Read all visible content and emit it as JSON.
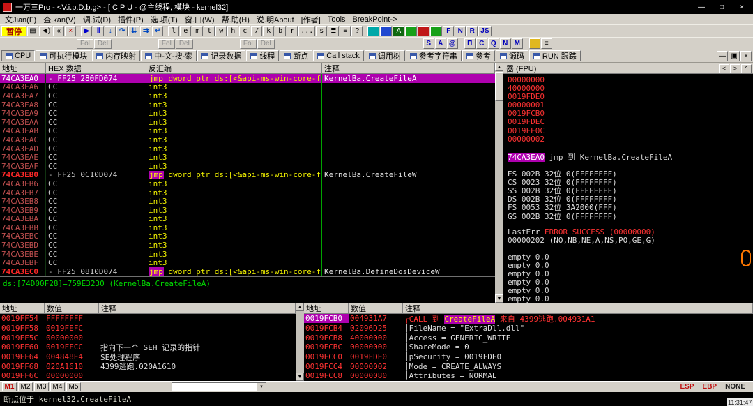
{
  "titlebar": {
    "title": "一万三Pro - <V.i.p.D.b.g> - [ C P U - @主线程, 模块 - kernel32]",
    "minimize": "—",
    "maximize": "□",
    "close": "×"
  },
  "menubar": {
    "items": [
      "文Jian(F)",
      "查.kan(V)",
      "调.试(D)",
      "插件(P)",
      "选.项(T)",
      "窗.口(W)",
      "帮.助(H)",
      "说.明About",
      "[作者]",
      "Tools",
      "BreakPoint->"
    ]
  },
  "toolbar_main": {
    "items": [
      {
        "name": "pause-button",
        "label": "暂停",
        "kind": "pause"
      },
      {
        "name": "log-window-icon",
        "label": "▤",
        "kind": "icon"
      },
      {
        "name": "sound-toggle-icon",
        "label": "◄)",
        "kind": "icon"
      },
      {
        "name": "restart-icon",
        "label": "«",
        "kind": "icon"
      },
      {
        "name": "close-program-icon",
        "label": "×",
        "kind": "icon red"
      },
      {
        "kind": "sep"
      },
      {
        "name": "run-button",
        "label": "▶",
        "kind": "icon blue"
      },
      {
        "name": "pause-execution-button",
        "label": "Ⅱ",
        "kind": "icon blue"
      },
      {
        "name": "step-into-button",
        "label": "↓",
        "kind": "step"
      },
      {
        "name": "step-over-button",
        "label": "↷",
        "kind": "step"
      },
      {
        "name": "animate-into-button",
        "label": "⇊",
        "kind": "step"
      },
      {
        "name": "animate-over-button",
        "label": "⇉",
        "kind": "step"
      },
      {
        "name": "execute-till-return-button",
        "label": "↵",
        "kind": "step"
      },
      {
        "kind": "sep"
      },
      {
        "name": "log-button",
        "label": "l",
        "kind": "letter"
      },
      {
        "name": "executables-button",
        "label": "e",
        "kind": "letter"
      },
      {
        "name": "memory-button",
        "label": "m",
        "kind": "letter"
      },
      {
        "name": "threads-button",
        "label": "t",
        "kind": "letter"
      },
      {
        "name": "windows-button",
        "label": "w",
        "kind": "letter"
      },
      {
        "name": "handles-button",
        "label": "h",
        "kind": "letter"
      },
      {
        "name": "cpu-button",
        "label": "c",
        "kind": "letter"
      },
      {
        "name": "patches-button",
        "label": "/",
        "kind": "letter"
      },
      {
        "name": "callstack-button",
        "label": "k",
        "kind": "letter"
      },
      {
        "name": "breakpoints-button",
        "label": "b",
        "kind": "letter"
      },
      {
        "name": "references-button",
        "label": "r",
        "kind": "letter"
      },
      {
        "name": "runtrace-button",
        "label": "...",
        "kind": "letter"
      },
      {
        "name": "source-button",
        "label": "s",
        "kind": "letter"
      },
      {
        "name": "windows-list-icon",
        "label": "≣",
        "kind": "icon"
      },
      {
        "name": "options-list-icon",
        "label": "≡",
        "kind": "icon"
      },
      {
        "name": "help-button",
        "label": "?",
        "kind": "icon"
      },
      {
        "kind": "sep"
      },
      {
        "name": "plugin-button-1",
        "label": "",
        "kind": "sw sw-teal"
      },
      {
        "name": "plugin-button-2",
        "label": "",
        "kind": "sw sw-blue"
      },
      {
        "name": "plugin-button-3",
        "label": "A",
        "kind": "sw sw-green"
      },
      {
        "name": "plugin-button-4",
        "label": "",
        "kind": "sw sw-green2"
      },
      {
        "name": "plugin-button-5",
        "label": "",
        "kind": "sw sw-red"
      },
      {
        "name": "plugin-button-6",
        "label": "",
        "kind": "sw sw-green2"
      },
      {
        "name": "f-plugin-button",
        "label": "F",
        "kind": "letterblue"
      },
      {
        "name": "n-plugin-button",
        "label": "N",
        "kind": "letterblue"
      },
      {
        "name": "r-plugin-button",
        "label": "R",
        "kind": "letterblue"
      },
      {
        "name": "js-plugin-button",
        "label": "JS",
        "kind": "letterblue"
      }
    ]
  },
  "toolbar_fol": {
    "groups": [
      [
        "Fol",
        "Del"
      ],
      [
        "Fol",
        "Del"
      ],
      [
        "Fol",
        "Del"
      ]
    ],
    "right_items": [
      {
        "name": "s-button",
        "label": "S",
        "kind": "letterblue"
      },
      {
        "name": "a-button",
        "label": "A",
        "kind": "letterblue"
      },
      {
        "name": "at-button",
        "label": "@",
        "kind": "letterblue"
      },
      {
        "name": "pi-button",
        "label": "Π",
        "kind": "letterblue gapl"
      },
      {
        "name": "c-button",
        "label": "C",
        "kind": "letterblue"
      },
      {
        "name": "q-button",
        "label": "Q",
        "kind": "letterblue"
      },
      {
        "name": "n-button",
        "label": "N",
        "kind": "letterblue"
      },
      {
        "name": "m-button",
        "label": "M",
        "kind": "letterblue"
      },
      {
        "name": "script-icon",
        "label": "",
        "kind": "gold gapl"
      },
      {
        "name": "list-icon",
        "label": "≡",
        "kind": "icon"
      }
    ]
  },
  "tabbar": {
    "tabs": [
      {
        "name": "cpu",
        "label": "CPU",
        "active": true
      },
      {
        "name": "executable-modules",
        "label": "可执行模块"
      },
      {
        "name": "memory-map",
        "label": "内存映射"
      },
      {
        "name": "chinese-search",
        "label": "中-文-搜-索"
      },
      {
        "name": "record-data",
        "label": "记录数据"
      },
      {
        "name": "threads",
        "label": "线程"
      },
      {
        "name": "breakpoints",
        "label": "断点"
      },
      {
        "name": "call-stack",
        "label": "Call stack"
      },
      {
        "name": "call-tree",
        "label": "调用树"
      },
      {
        "name": "reference-strings",
        "label": "参考字符串"
      },
      {
        "name": "references",
        "label": "参考"
      },
      {
        "name": "source",
        "label": "源码"
      },
      {
        "name": "run-trace",
        "label": "RUN 跟踪"
      }
    ],
    "mdi": {
      "minimize": "—",
      "restore": "▣",
      "close": "×"
    }
  },
  "disasm": {
    "headers": [
      "地址",
      "HEX 数据",
      "反汇编",
      "注释"
    ],
    "rows": [
      {
        "addr": "74CA3EA0",
        "hex": "- FF25 280FD074",
        "mn": "jmp",
        "op": "dword ptr ds:[<&api-ms-win-core-fil",
        "comment": "KernelBa.CreateFileA",
        "sel": true
      },
      {
        "addr": "74CA3EA6",
        "hex": "CC",
        "mn": "int3"
      },
      {
        "addr": "74CA3EA7",
        "hex": "CC",
        "mn": "int3"
      },
      {
        "addr": "74CA3EA8",
        "hex": "CC",
        "mn": "int3"
      },
      {
        "addr": "74CA3EA9",
        "hex": "CC",
        "mn": "int3"
      },
      {
        "addr": "74CA3EAA",
        "hex": "CC",
        "mn": "int3"
      },
      {
        "addr": "74CA3EAB",
        "hex": "CC",
        "mn": "int3"
      },
      {
        "addr": "74CA3EAC",
        "hex": "CC",
        "mn": "int3"
      },
      {
        "addr": "74CA3EAD",
        "hex": "CC",
        "mn": "int3"
      },
      {
        "addr": "74CA3EAE",
        "hex": "CC",
        "mn": "int3"
      },
      {
        "addr": "74CA3EAF",
        "hex": "CC",
        "mn": "int3"
      },
      {
        "addr": "74CA3EB0",
        "hex": "- FF25 0C10D074",
        "mn": "jmp",
        "op": "dword ptr ds:[<&api-ms-win-core-fil",
        "comment": "KernelBa.CreateFileW",
        "bp": true
      },
      {
        "addr": "74CA3EB6",
        "hex": "CC",
        "mn": "int3"
      },
      {
        "addr": "74CA3EB7",
        "hex": "CC",
        "mn": "int3"
      },
      {
        "addr": "74CA3EB8",
        "hex": "CC",
        "mn": "int3"
      },
      {
        "addr": "74CA3EB9",
        "hex": "CC",
        "mn": "int3"
      },
      {
        "addr": "74CA3EBA",
        "hex": "CC",
        "mn": "int3"
      },
      {
        "addr": "74CA3EBB",
        "hex": "CC",
        "mn": "int3"
      },
      {
        "addr": "74CA3EBC",
        "hex": "CC",
        "mn": "int3"
      },
      {
        "addr": "74CA3EBD",
        "hex": "CC",
        "mn": "int3"
      },
      {
        "addr": "74CA3EBE",
        "hex": "CC",
        "mn": "int3"
      },
      {
        "addr": "74CA3EBF",
        "hex": "CC",
        "mn": "int3"
      },
      {
        "addr": "74CA3EC0",
        "hex": "- FF25 0810D074",
        "mn": "jmp",
        "op": "dword ptr ds:[<&api-ms-win-core-fil",
        "comment": "KernelBa.DefineDosDeviceW",
        "bp": true
      }
    ]
  },
  "info_line": "ds:[74D00F28]=759E3230 (KernelBa.CreateFileA)",
  "registers": {
    "title": "器 (FPU)",
    "nav": [
      "<",
      ">",
      "^"
    ],
    "lines": [
      {
        "parts": [
          {
            "t": "00000000",
            "c": "val"
          }
        ]
      },
      {
        "parts": [
          {
            "t": "40000000",
            "c": "val"
          }
        ]
      },
      {
        "parts": [
          {
            "t": "0019FDE0",
            "c": "val"
          }
        ]
      },
      {
        "parts": [
          {
            "t": "00000001",
            "c": "val"
          }
        ]
      },
      {
        "parts": [
          {
            "t": "0019FCB0",
            "c": "val"
          }
        ]
      },
      {
        "parts": [
          {
            "t": "0019FDEC",
            "c": "val"
          }
        ]
      },
      {
        "parts": [
          {
            "t": "0019FE0C",
            "c": "val"
          }
        ]
      },
      {
        "parts": [
          {
            "t": "00000002",
            "c": "val"
          }
        ]
      },
      {
        "parts": []
      },
      {
        "parts": [
          {
            "t": "74CA3EA0",
            "c": "eip"
          },
          {
            "t": " jmp 到 KernelBa.CreateFileA",
            "c": "txt"
          }
        ]
      },
      {
        "parts": []
      },
      {
        "parts": [
          {
            "t": "ES 002B 32位 0(FFFFFFFF)",
            "c": "txt"
          }
        ]
      },
      {
        "parts": [
          {
            "t": "CS 0023 32位 0(FFFFFFFF)",
            "c": "txt"
          }
        ]
      },
      {
        "parts": [
          {
            "t": "SS 002B 32位 0(FFFFFFFF)",
            "c": "txt"
          }
        ]
      },
      {
        "parts": [
          {
            "t": "DS 002B 32位 0(FFFFFFFF)",
            "c": "txt"
          }
        ]
      },
      {
        "parts": [
          {
            "t": "FS 0053 32位 3A2000(FFF)",
            "c": "txt"
          }
        ]
      },
      {
        "parts": [
          {
            "t": "GS 002B 32位 0(FFFFFFFF)",
            "c": "txt"
          }
        ]
      },
      {
        "parts": []
      },
      {
        "parts": [
          {
            "t": "LastErr ",
            "c": "txt"
          },
          {
            "t": "ERROR_SUCCESS (00000000)",
            "c": "val"
          }
        ]
      },
      {
        "parts": [
          {
            "t": "00000202 (NO,NB,NE,A,NS,PO,GE,G)",
            "c": "txt"
          }
        ]
      },
      {
        "parts": []
      },
      {
        "parts": [
          {
            "t": "empty 0.0",
            "c": "txt"
          }
        ]
      },
      {
        "parts": [
          {
            "t": "empty 0.0",
            "c": "txt"
          }
        ]
      },
      {
        "parts": [
          {
            "t": "empty 0.0",
            "c": "txt"
          }
        ]
      },
      {
        "parts": [
          {
            "t": "empty 0.0",
            "c": "txt"
          }
        ]
      },
      {
        "parts": [
          {
            "t": "empty 0.0",
            "c": "txt"
          }
        ]
      },
      {
        "parts": [
          {
            "t": "empty 0.0",
            "c": "txt"
          }
        ]
      }
    ]
  },
  "stack_left": {
    "headers": [
      "地址",
      "数值",
      "注释"
    ],
    "rows": [
      {
        "addr": "0019FF54",
        "val": "FFFFFFFF",
        "comment": ""
      },
      {
        "addr": "0019FF58",
        "val": "0019FEFC",
        "comment": ""
      },
      {
        "addr": "0019FF5C",
        "val": "00000000",
        "comment": ""
      },
      {
        "addr": "0019FF60",
        "val": "0019FFCC",
        "comment": "指向下一个 SEH 记录的指针"
      },
      {
        "addr": "0019FF64",
        "val": "004848E4",
        "comment": "SE处理程序"
      },
      {
        "addr": "0019FF68",
        "val": "020A1610",
        "comment": "4399逃跑.020A1610"
      },
      {
        "addr": "0019FF6C",
        "val": "00000000",
        "comment": ""
      }
    ]
  },
  "stack_right": {
    "headers": [
      "地址",
      "数值",
      "注释"
    ],
    "rows": [
      {
        "addr": "0019FCB0",
        "val": "004931A7",
        "sel": true,
        "parts": [
          {
            "t": "┌CALL 到 ",
            "c": "red"
          },
          {
            "t": "CreateFileA",
            "c": "hl"
          },
          {
            "t": " 来自 4399逃跑.004931A1",
            "c": "red"
          }
        ]
      },
      {
        "addr": "0019FCB4",
        "val": "02096D25",
        "parts": [
          {
            "t": "│FileName = \"ExtraDll.dll\"",
            "c": "txt"
          }
        ]
      },
      {
        "addr": "0019FCB8",
        "val": "40000000",
        "parts": [
          {
            "t": "│Access = GENERIC_WRITE",
            "c": "txt"
          }
        ]
      },
      {
        "addr": "0019FCBC",
        "val": "00000000",
        "parts": [
          {
            "t": "│ShareMode = 0",
            "c": "txt"
          }
        ]
      },
      {
        "addr": "0019FCC0",
        "val": "0019FDE0",
        "parts": [
          {
            "t": "│pSecurity = 0019FDE0",
            "c": "txt"
          }
        ]
      },
      {
        "addr": "0019FCC4",
        "val": "00000002",
        "parts": [
          {
            "t": "│Mode = CREATE_ALWAYS",
            "c": "txt"
          }
        ]
      },
      {
        "addr": "0019FCC8",
        "val": "00000080",
        "parts": [
          {
            "t": "│Attributes = NORMAL",
            "c": "txt"
          }
        ]
      }
    ]
  },
  "scrollbar": {
    "up": "▲",
    "down": "▼"
  },
  "bottom_bar": {
    "m_tabs": [
      "M1",
      "M2",
      "M3",
      "M4",
      "M5"
    ],
    "combo_arrow": "▼",
    "right_labels": [
      "ESP",
      "EBP",
      "NONE"
    ]
  },
  "status_bar": {
    "text": "断点位于 kernel32.CreateFileA",
    "clock": "11:31:47"
  }
}
